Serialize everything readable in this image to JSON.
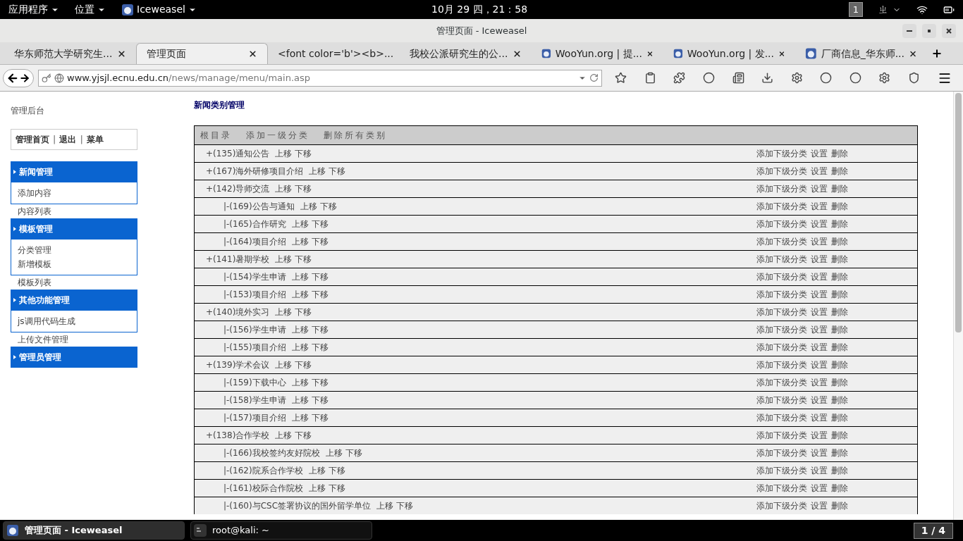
{
  "top_bar": {
    "menus": [
      "应用程序",
      "位置",
      "Iceweasel"
    ],
    "clock": "10月 29 四，21：58",
    "workspace": "1",
    "input_method": "ㄓ"
  },
  "window": {
    "title": "管理页面 - Iceweasel"
  },
  "tabs": [
    {
      "label": "华东师范大学研究生...",
      "selected": false,
      "icon": false
    },
    {
      "label": "管理页面",
      "selected": true,
      "icon": false
    },
    {
      "label": "<font color='b'><b>...",
      "selected": false,
      "icon": false
    },
    {
      "label": "我校公派研究生的公...",
      "selected": false,
      "icon": false
    },
    {
      "label": "WooYun.org | 提...",
      "selected": false,
      "icon": true
    },
    {
      "label": "WooYun.org | 发...",
      "selected": false,
      "icon": true
    },
    {
      "label": "厂商信息_华东师...",
      "selected": false,
      "icon": true
    }
  ],
  "address": {
    "host": "www.yjsjl.ecnu.edu.cn",
    "path": "/news/manage/menu/main.asp"
  },
  "sidebar": {
    "title": "管理后台",
    "links": [
      "管理首页",
      "退出",
      "菜单"
    ],
    "separator": "|",
    "sections": [
      {
        "title": "新闻管理",
        "items": [
          "添加内容"
        ],
        "extra": [
          "内容列表"
        ]
      },
      {
        "title": "模板管理",
        "items": [
          "分类管理",
          "新增模板"
        ],
        "extra": [
          "模板列表"
        ]
      },
      {
        "title": "其他功能管理",
        "items": [
          "js调用代码生成"
        ],
        "extra": [
          "上传文件管理"
        ]
      },
      {
        "title": "管理员管理"
      }
    ]
  },
  "page": {
    "heading": "新闻类别管理",
    "toolbar": [
      "根目录",
      "添加一级分类",
      "删除所有类别"
    ],
    "rows": [
      {
        "label": "+(135)通知公告",
        "moves": [
          "上移",
          "下移"
        ],
        "actions": [
          "添加下级分类",
          "设置",
          "删除"
        ],
        "children": []
      },
      {
        "label": "+(167)海外研修项目介绍",
        "moves": [
          "上移",
          "下移"
        ],
        "actions": [
          "添加下级分类",
          "设置",
          "删除"
        ],
        "children": []
      },
      {
        "label": "+(142)导师交流",
        "moves": [
          "上移",
          "下移"
        ],
        "actions": [
          "添加下级分类",
          "设置",
          "删除"
        ],
        "children": [
          {
            "label": "|-(169)公告与通知",
            "moves": [
              "上移",
              "下移"
            ],
            "actions": [
              "添加下级分类",
              "设置",
              "删除"
            ]
          },
          {
            "label": "|-(165)合作研究",
            "moves": [
              "上移",
              "下移"
            ],
            "actions": [
              "添加下级分类",
              "设置",
              "删除"
            ]
          },
          {
            "label": "|-(164)项目介绍",
            "moves": [
              "上移",
              "下移"
            ],
            "actions": [
              "添加下级分类",
              "设置",
              "删除"
            ]
          }
        ]
      },
      {
        "label": "+(141)暑期学校",
        "moves": [
          "上移",
          "下移"
        ],
        "actions": [
          "添加下级分类",
          "设置",
          "删除"
        ],
        "children": [
          {
            "label": "|-(154)学生申请",
            "moves": [
              "上移",
              "下移"
            ],
            "actions": [
              "添加下级分类",
              "设置",
              "删除"
            ]
          },
          {
            "label": "|-(153)项目介绍",
            "moves": [
              "上移",
              "下移"
            ],
            "actions": [
              "添加下级分类",
              "设置",
              "删除"
            ]
          }
        ]
      },
      {
        "label": "+(140)境外实习",
        "moves": [
          "上移",
          "下移"
        ],
        "actions": [
          "添加下级分类",
          "设置",
          "删除"
        ],
        "children": [
          {
            "label": "|-(156)学生申请",
            "moves": [
              "上移",
              "下移"
            ],
            "actions": [
              "添加下级分类",
              "设置",
              "删除"
            ]
          },
          {
            "label": "|-(155)项目介绍",
            "moves": [
              "上移",
              "下移"
            ],
            "actions": [
              "添加下级分类",
              "设置",
              "删除"
            ]
          }
        ]
      },
      {
        "label": "+(139)学术会议",
        "moves": [
          "上移",
          "下移"
        ],
        "actions": [
          "添加下级分类",
          "设置",
          "删除"
        ],
        "children": [
          {
            "label": "|-(159)下载中心",
            "moves": [
              "上移",
              "下移"
            ],
            "actions": [
              "添加下级分类",
              "设置",
              "删除"
            ]
          },
          {
            "label": "|-(158)学生申请",
            "moves": [
              "上移",
              "下移"
            ],
            "actions": [
              "添加下级分类",
              "设置",
              "删除"
            ]
          },
          {
            "label": "|-(157)项目介绍",
            "moves": [
              "上移",
              "下移"
            ],
            "actions": [
              "添加下级分类",
              "设置",
              "删除"
            ]
          }
        ]
      },
      {
        "label": "+(138)合作学校",
        "moves": [
          "上移",
          "下移"
        ],
        "actions": [
          "添加下级分类",
          "设置",
          "删除"
        ],
        "children": [
          {
            "label": "|-(166)我校签约友好院校",
            "moves": [
              "上移",
              "下移"
            ],
            "actions": [
              "添加下级分类",
              "设置",
              "删除"
            ]
          },
          {
            "label": "|-(162)院系合作学校",
            "moves": [
              "上移",
              "下移"
            ],
            "actions": [
              "添加下级分类",
              "设置",
              "删除"
            ]
          },
          {
            "label": "|-(161)校际合作院校",
            "moves": [
              "上移",
              "下移"
            ],
            "actions": [
              "添加下级分类",
              "设置",
              "删除"
            ]
          },
          {
            "label": "|-(160)与CSC签署协议的国外留学单位",
            "moves": [
              "上移",
              "下移"
            ],
            "actions": [
              "添加下级分类",
              "设置",
              "删除"
            ]
          }
        ]
      }
    ]
  },
  "taskbar": {
    "windows": [
      {
        "label": "管理页面 - Iceweasel",
        "selected": true,
        "kind": "browser"
      },
      {
        "label": "root@kali: ~",
        "selected": false,
        "kind": "terminal"
      }
    ],
    "pager": "1 / 4"
  }
}
